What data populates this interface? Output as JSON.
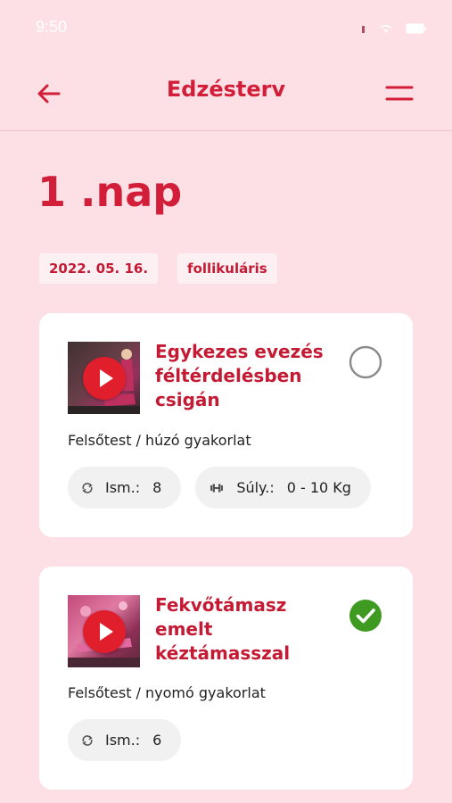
{
  "status_bar": {
    "time": "9:50"
  },
  "header": {
    "title": "Edzésterv",
    "back_icon": "arrow-left-icon",
    "menu_icon": "hamburger-menu-icon"
  },
  "day": {
    "title": "1 .nap",
    "tags": [
      "2022. 05. 16.",
      "follikuláris"
    ]
  },
  "exercises": [
    {
      "title": "Egykezes evezés féltérdelésben csigán",
      "category": "Felsőtest / húzó gyakorlat",
      "done": false,
      "reps_label": "Ism.:",
      "reps_value": "8",
      "weight_label": "Súly.:",
      "weight_value": "0 - 10 Kg"
    },
    {
      "title": "Fekvőtámasz emelt kéztámasszal",
      "category": "Felsőtest / nyomó gyakorlat",
      "done": true,
      "reps_label": "Ism.:",
      "reps_value": "6"
    }
  ],
  "colors": {
    "background": "#fce0e6",
    "accent": "#d21e38",
    "play_button": "#e01e2c",
    "done_check": "#3f9a21",
    "pill_background": "#f1f1f1",
    "tag_background": "#fdf0f3"
  }
}
